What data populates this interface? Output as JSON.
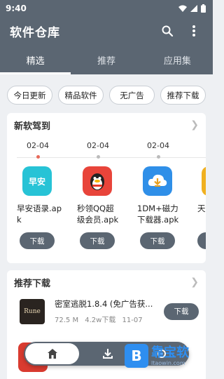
{
  "status": {
    "time": "9:40"
  },
  "toolbar": {
    "title": "软件仓库",
    "search_icon": "search-icon",
    "more_icon": "more-vert-icon"
  },
  "tabs": [
    {
      "label": "精选",
      "active": true
    },
    {
      "label": "推荐",
      "active": false
    },
    {
      "label": "应用集",
      "active": false
    }
  ],
  "chips": [
    "今日更新",
    "精品软件",
    "无广告",
    "推荐下载"
  ],
  "new_software": {
    "title": "新软驾到",
    "dates": [
      "02-04",
      "02-04",
      "02-04"
    ],
    "apps": [
      {
        "name": "早安语录.apk",
        "icon_color": "#27c3d6",
        "icon_text": "早安",
        "button": "下载"
      },
      {
        "name": "秒领QQ超级会员.apk",
        "icon_color": "#e8443a",
        "icon_text": "QQ",
        "button": "下载"
      },
      {
        "name": "1DM+磁力下载器.apk",
        "icon_color": "#2f8fe8",
        "icon_text": "↓",
        "button": "下载"
      },
      {
        "name": "天v.a",
        "icon_color": "#f0b020",
        "icon_text": "",
        "button": ""
      }
    ]
  },
  "recommended": {
    "title": "推荐下载",
    "items": [
      {
        "name": "密室逃脱1.8.4 (免广告获...",
        "size": "72.5 M",
        "downloads": "4.2w下载",
        "date": "11-07",
        "button": "下载",
        "icon_text": "Rune"
      }
    ]
  },
  "bottom_nav": [
    {
      "icon": "home-icon",
      "active": true
    },
    {
      "icon": "download-icon",
      "active": false
    },
    {
      "icon": "settings-icon",
      "active": false
    }
  ],
  "watermark": {
    "name": "靠宝软",
    "url": "ltaowin.com",
    "logo": "B"
  },
  "colors": {
    "primary": "#5b6672",
    "accent_red": "#e86a5a",
    "background": "#eef0f3"
  }
}
